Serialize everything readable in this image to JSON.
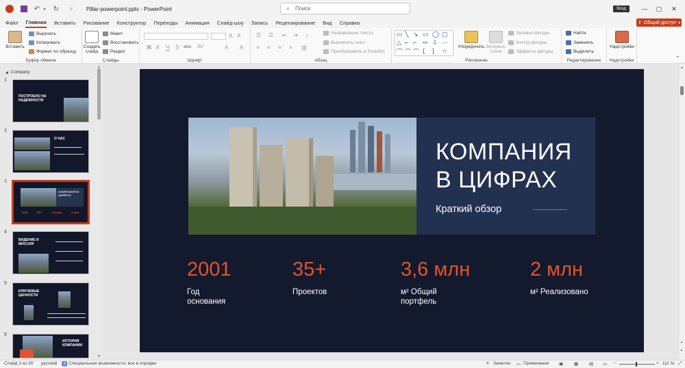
{
  "titlebar": {
    "doc_title": "Pillar-powerpoint.pptx  -  PowerPoint",
    "search_placeholder": "Поиск",
    "login_label": "Вход",
    "minimize": "—",
    "maximize": "▢",
    "close": "✕"
  },
  "tabs": [
    "Файл",
    "Главная",
    "Вставить",
    "Рисование",
    "Конструктор",
    "Переходы",
    "Анимация",
    "Слайд-шоу",
    "Запись",
    "Рецензирование",
    "Вид",
    "Справка"
  ],
  "active_tab": "Главная",
  "share_label": "Общий доступ",
  "ribbon": {
    "clipboard": {
      "paste": "Вставить",
      "cut": "Вырезать",
      "copy": "Копировать",
      "format_painter": "Формат по образцу",
      "label": "Буфер обмена"
    },
    "slides": {
      "new_slide": "Создать слайд",
      "layout": "Макет",
      "reset": "Восстановить",
      "section": "Раздел",
      "label": "Слайды"
    },
    "font": {
      "label": "Шрифт",
      "bold": "Ж",
      "italic": "К",
      "underline": "Ч",
      "shadow": "S",
      "strike": "abc",
      "spacing": "AV"
    },
    "paragraph": {
      "text_direction": "Направление текста",
      "align_text": "Выровнять текст",
      "smartart": "Преобразовать в SmartArt",
      "label": "Абзац"
    },
    "drawing": {
      "arrange": "Упорядочить",
      "quick_styles": "Экспресс-стили",
      "fill": "Заливка фигуры",
      "outline": "Контур фигуры",
      "effects": "Эффекты фигуры",
      "label": "Рисование"
    },
    "editing": {
      "find": "Найти",
      "replace": "Заменить",
      "select": "Выделить",
      "label": "Редактирование"
    },
    "addins": {
      "button": "Надстройки",
      "label": "Надстройки"
    }
  },
  "left_pane": {
    "section_label": "Company",
    "thumbnails": [
      {
        "num": "1",
        "text": "ПОСТРОЕНО НА НАДЁЖНОСТИ"
      },
      {
        "num": "2",
        "text": "О НАС"
      },
      {
        "num": "3",
        "text": "КОМПАНИЯ В ЦИФРАХ",
        "stats": [
          "2001",
          "35+",
          "3,6 млн",
          "2 млн"
        ]
      },
      {
        "num": "4",
        "text": "ВИДЕНИЕ И МИССИЯ"
      },
      {
        "num": "5",
        "text": "КЛЮЧЕВЫЕ ЦЕННОСТИ"
      },
      {
        "num": "6",
        "text": "ИСТОРИЯ КОМПАНИИ"
      }
    ]
  },
  "slide": {
    "title_line1": "КОМПАНИЯ",
    "title_line2": "В ЦИФРАХ",
    "subtitle": "Краткий обзор",
    "stats": [
      {
        "value": "2001",
        "label1": "Год",
        "label2": "основания"
      },
      {
        "value": "35+",
        "label1": "Проектов",
        "label2": ""
      },
      {
        "value": "3,6 млн",
        "label1": "м² Общий",
        "label2": "портфель"
      },
      {
        "value": "2 млн",
        "label1": "м² Реализовано",
        "label2": ""
      }
    ]
  },
  "statusbar": {
    "slide_counter": "Слайд 3 из 30",
    "language": "русский",
    "accessibility": "Специальные возможности: все в порядке",
    "notes": "Заметки",
    "comments": "Примечания",
    "zoom_minus": "−",
    "zoom_plus": "+",
    "zoom_level": "111 %"
  },
  "colors": {
    "accent": "#c43e1c",
    "slide_bg": "#131a2d",
    "slide_panel": "#233150",
    "stat_orange": "#e2532f"
  }
}
